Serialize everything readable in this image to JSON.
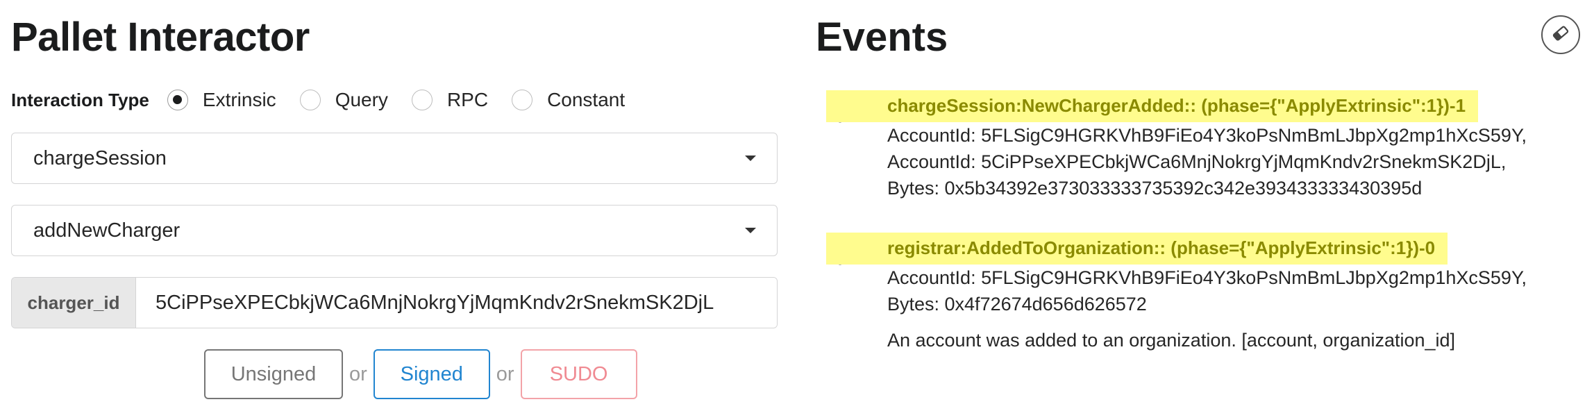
{
  "interactor": {
    "title": "Pallet Interactor",
    "interaction_type_label": "Interaction Type",
    "interaction_types": [
      {
        "label": "Extrinsic",
        "checked": true
      },
      {
        "label": "Query",
        "checked": false
      },
      {
        "label": "RPC",
        "checked": false
      },
      {
        "label": "Constant",
        "checked": false
      }
    ],
    "pallet_select": "chargeSession",
    "callable_select": "addNewCharger",
    "param": {
      "label": "charger_id",
      "value": "5CiPPseXPECbkjWCa6MnjNokrgYjMqmKndv2rSnekmSK2DjL"
    },
    "buttons": {
      "unsigned": "Unsigned",
      "signed": "Signed",
      "sudo": "SUDO",
      "or": "or"
    }
  },
  "events": {
    "title": "Events",
    "clear_icon": "eraser-icon",
    "items": [
      {
        "icon": "bell-icon",
        "header": "chargeSession:NewChargerAdded:: (phase={\"ApplyExtrinsic\":1})-1",
        "lines": [
          "AccountId: 5FLSigC9HGRKVhB9FiEo4Y3koPsNmBmLJbpXg2mp1hXcS59Y,",
          "AccountId: 5CiPPseXPECbkjWCa6MnjNokrgYjMqmKndv2rSnekmSK2DjL,",
          "Bytes: 0x5b34392e373033333735392c342e393433333430395d"
        ],
        "description": ""
      },
      {
        "icon": "bell-icon",
        "header": "registrar:AddedToOrganization:: (phase={\"ApplyExtrinsic\":1})-0",
        "lines": [
          "AccountId: 5FLSigC9HGRKVhB9FiEo4Y3koPsNmBmLJbpXg2mp1hXcS59Y,",
          "Bytes: 0x4f72674d656d626572"
        ],
        "description": "An account was added to an organization. [account, organization_id]"
      }
    ]
  },
  "colors": {
    "highlight": "#fffc8e",
    "signed": "#2185d0",
    "sudo": "#f08a92"
  }
}
